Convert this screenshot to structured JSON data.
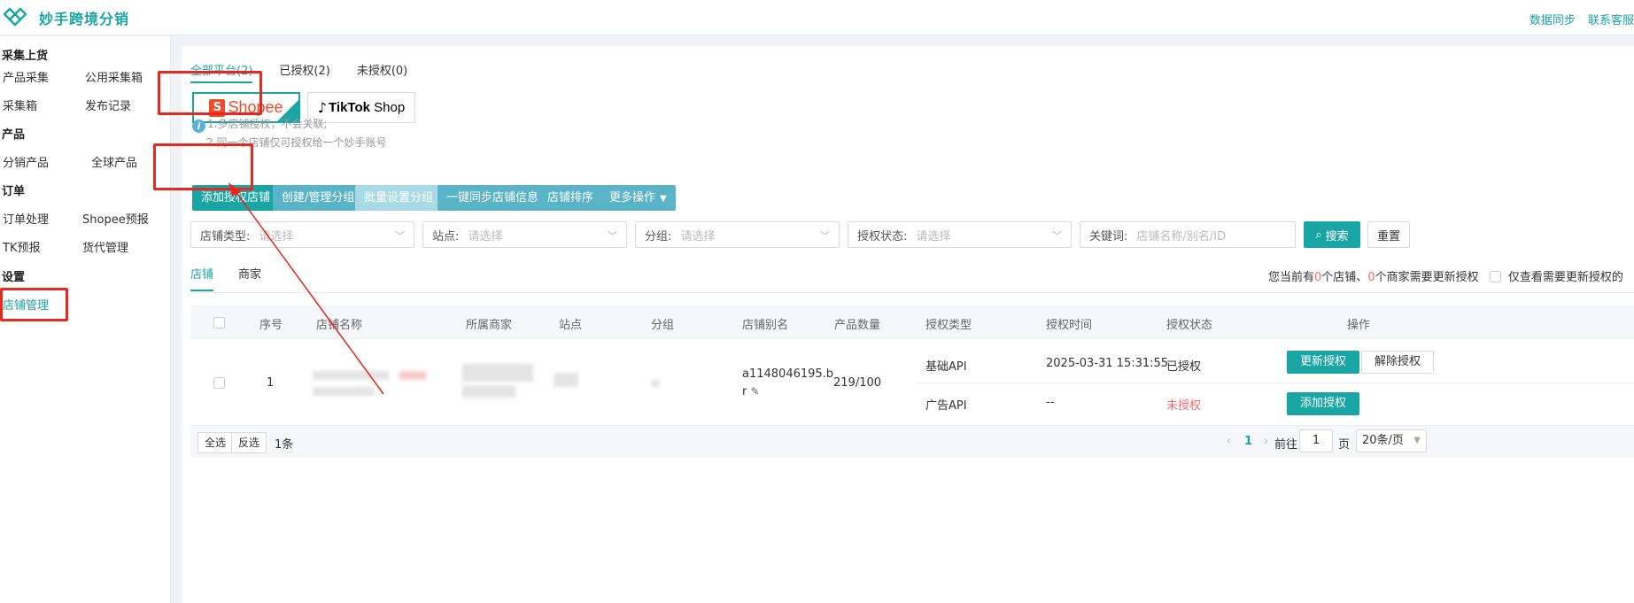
{
  "app": {
    "title": "妙手跨境分销"
  },
  "topbar": {
    "links": [
      "数据同步",
      "联系客服"
    ]
  },
  "sidebar": {
    "groups": [
      {
        "title": "采集上货",
        "items": [
          "产品采集",
          "公用采集箱",
          "采集箱",
          "发布记录"
        ]
      },
      {
        "title": "产品",
        "items": [
          "分销产品",
          "全球产品"
        ]
      },
      {
        "title": "订单",
        "items": [
          "订单处理",
          "Shopee预报",
          "TK预报",
          "货代管理"
        ]
      },
      {
        "title": "设置",
        "items": [
          "店铺管理"
        ]
      }
    ],
    "active_item": "店铺管理"
  },
  "platform_tabs": [
    {
      "label": "全部平台(2)",
      "active": true
    },
    {
      "label": "已授权(2)",
      "active": false
    },
    {
      "label": "未授权(0)",
      "active": false
    }
  ],
  "platforms": {
    "shopee": {
      "badge": "S",
      "name": "Shopee"
    },
    "tiktok": {
      "name": "TikTok",
      "suffix": " Shop"
    }
  },
  "tips": {
    "icon": "info-icon",
    "line1": "1.多店铺授权，不会关联;",
    "line2": "2.同一个店铺仅可授权给一个妙手账号"
  },
  "actions": {
    "add_store": "添加授权店铺",
    "create_group": "创建/管理分组",
    "batch_group": "批量设置分组",
    "sync_info": "一键同步店铺信息",
    "sort": "店铺排序",
    "more": "更多操作"
  },
  "filters": {
    "store_type": {
      "label": "店铺类型:",
      "placeholder": "请选择"
    },
    "site": {
      "label": "站点:",
      "placeholder": "请选择"
    },
    "group": {
      "label": "分组:",
      "placeholder": "请选择"
    },
    "auth_status": {
      "label": "授权状态:",
      "placeholder": "请选择"
    },
    "keyword": {
      "label": "关键词:",
      "placeholder": "店铺名称/别名/ID"
    },
    "search": "搜索",
    "reset": "重置"
  },
  "sub_tabs": [
    {
      "label": "店铺",
      "active": true
    },
    {
      "label": "商家",
      "active": false
    }
  ],
  "notice": {
    "prefix": "您当前有",
    "store_count": "0",
    "middle": "个店铺、",
    "merchant_count": "0",
    "suffix": "个商家需要更新授权",
    "filter_label": "仅查看需要更新授权的"
  },
  "table": {
    "headers": [
      "序号",
      "店铺名称",
      "所属商家",
      "站点",
      "分组",
      "店铺别名",
      "产品数量",
      "授权类型",
      "授权时间",
      "授权状态",
      "操作"
    ],
    "rows": [
      {
        "index": "1",
        "alias_line1": "a1148046195.b",
        "alias_line2": "r",
        "product_count": "219/100",
        "auths": [
          {
            "type": "基础API",
            "time": "2025-03-31 15:31:55",
            "status": "已授权",
            "status_color": "#333333",
            "primary_action": "更新授权",
            "secondary_action": "解除授权"
          },
          {
            "type": "广告API",
            "time": "--",
            "status": "未授权",
            "status_color": "#f56c6c",
            "primary_action": "添加授权"
          }
        ]
      }
    ]
  },
  "footer": {
    "select_all": "全选",
    "invert": "反选",
    "count": "1条",
    "current_page": "1",
    "goto_label": "前往",
    "page_input": "1",
    "page_unit": "页",
    "page_size": "20条/页"
  },
  "colors": {
    "accent": "#1aa5a5",
    "annotation": "#e8271f",
    "danger": "#f56c6c"
  }
}
